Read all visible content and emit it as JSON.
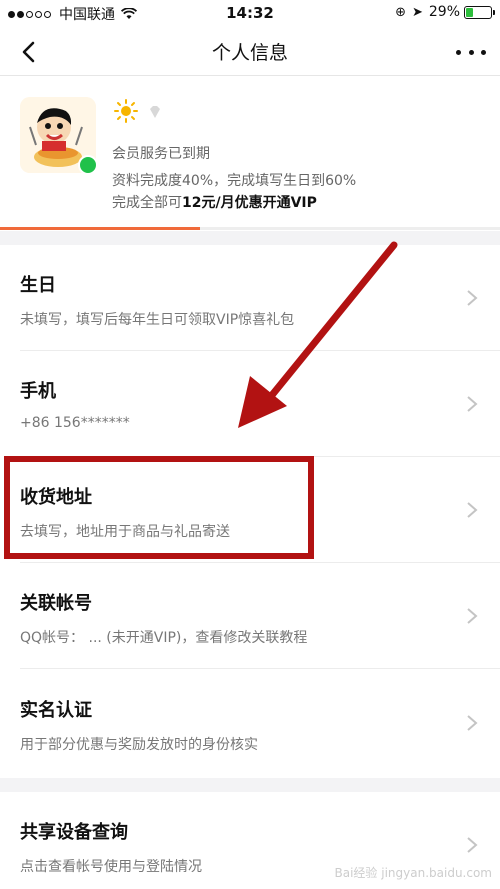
{
  "status_bar": {
    "carrier": "中国联通",
    "time": "14:32",
    "battery": "29%",
    "signal_bars_on": 2,
    "battery_level": 0.29
  },
  "nav": {
    "title": "个人信息",
    "back_icon": "chevron-left-icon",
    "more_icon": "more-dots-icon"
  },
  "profile": {
    "membership_status": "会员服务已到期",
    "completion_text": "资料完成度40%，完成填写生日到60%",
    "offer_prefix": "完成全部可",
    "offer_bold": "12元/月优惠开通VIP",
    "completion_progress": 0.4,
    "accent_color": "#f06a3a"
  },
  "rows": [
    {
      "title": "生日",
      "subtitle": "未填写，填写后每年生日可领取VIP惊喜礼包"
    },
    {
      "title": "手机",
      "subtitle": "+86 156*******"
    },
    {
      "title": "收货地址",
      "subtitle": "去填写，地址用于商品与礼品寄送"
    },
    {
      "title": "关联帐号",
      "subtitle": "QQ帐号：  ... (未开通VIP)，查看修改关联教程"
    },
    {
      "title": "实名认证",
      "subtitle": "用于部分优惠与奖励发放时的身份核实"
    },
    {
      "title": "共享设备查询",
      "subtitle": "点击查看帐号使用与登陆情况"
    }
  ],
  "annotation": {
    "highlight_color": "#b21212",
    "arrow_color": "#b21212"
  },
  "watermark": "Bai经验 jingyan.baidu.com"
}
